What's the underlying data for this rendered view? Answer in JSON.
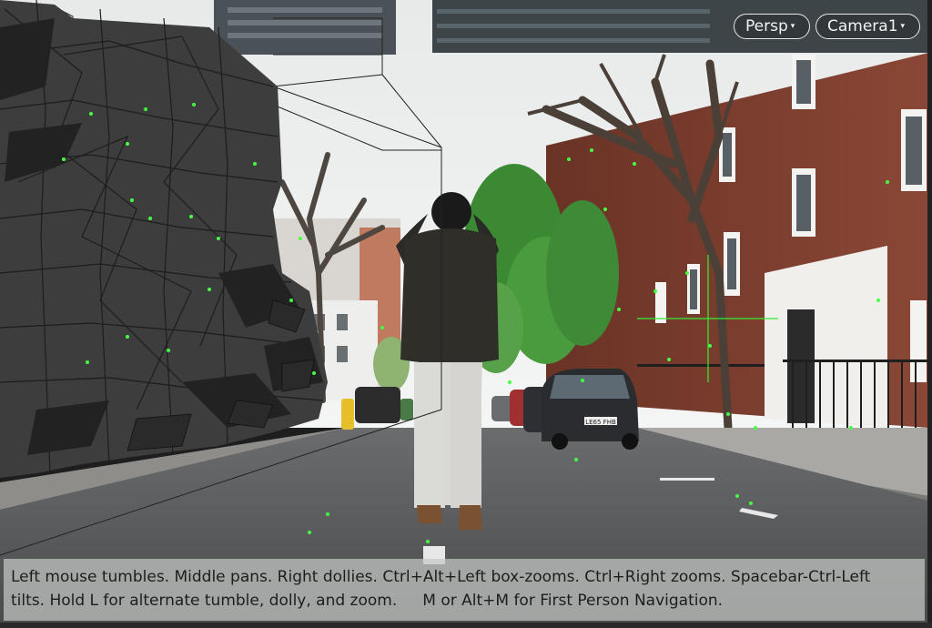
{
  "viewport": {
    "projection_label": "Persp",
    "camera_label": "Camera1",
    "caret": "▾"
  },
  "help": {
    "line1": "Left mouse tumbles. Middle pans. Right dollies. Ctrl+Alt+Left box-zooms. Ctrl+Right zooms. Spacebar-Ctrl-Left",
    "line2a": "tilts. Hold L for alternate tumble, dolly, and zoom.",
    "line2b": "M or Alt+M for First Person Navigation."
  },
  "scene": {
    "car_plate": "LE65 FHB"
  },
  "colors": {
    "sky": "#eceeee",
    "brick": "#7a3b2e",
    "road": "#58595b",
    "foliage": "#3f8a3a",
    "mesh": "#3c3c3c",
    "tracker": "#33ff33",
    "overlay": "#c4c8c4"
  }
}
